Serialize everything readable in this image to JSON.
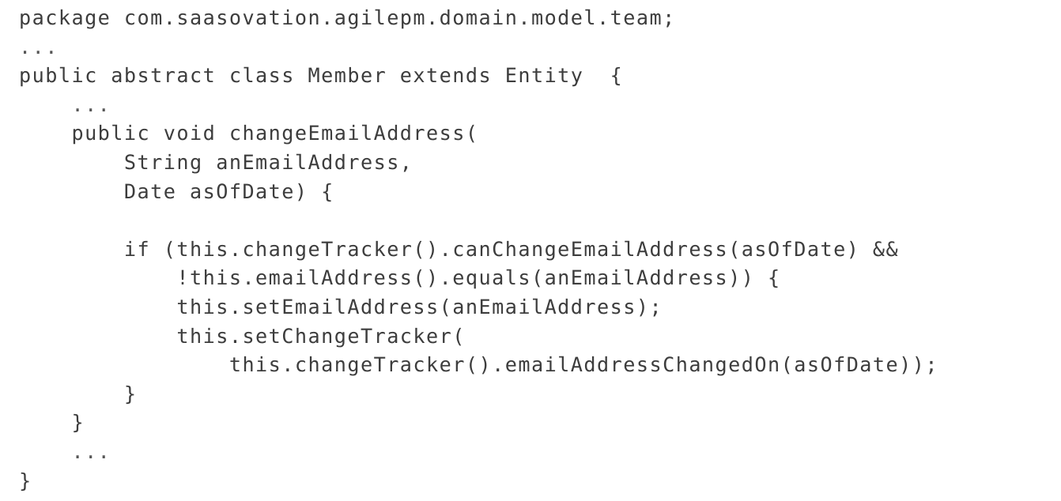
{
  "document": {
    "type": "code-listing",
    "language": "java",
    "background_color": "#ffffff",
    "text_color": "#2f2f2f",
    "lines": [
      "package com.saasovation.agilepm.domain.model.team;",
      "...",
      "public abstract class Member extends Entity  {",
      "    ...",
      "    public void changeEmailAddress(",
      "        String anEmailAddress,",
      "        Date asOfDate) {",
      "",
      "        if (this.changeTracker().canChangeEmailAddress(asOfDate) &&",
      "            !this.emailAddress().equals(anEmailAddress)) {",
      "            this.setEmailAddress(anEmailAddress);",
      "            this.setChangeTracker(",
      "                this.changeTracker().emailAddressChangedOn(asOfDate));",
      "        }",
      "    }",
      "    ...",
      "}"
    ]
  }
}
